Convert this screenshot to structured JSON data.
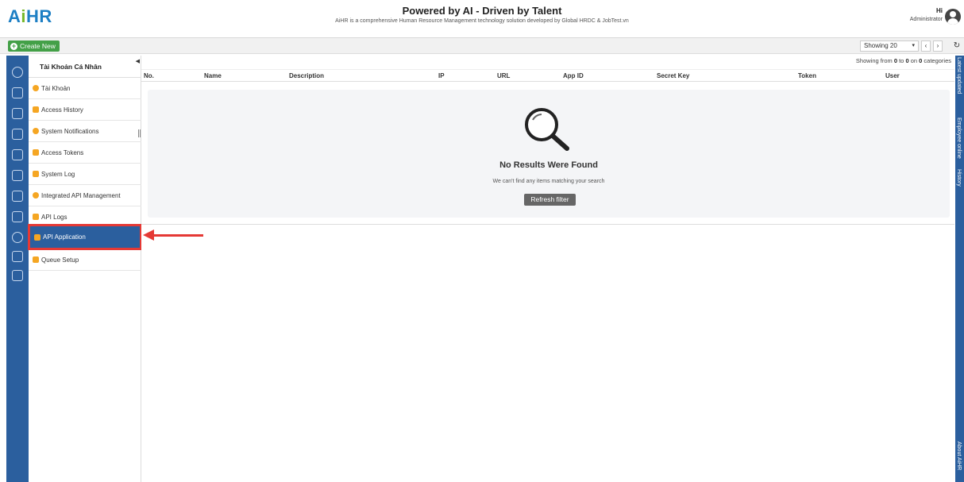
{
  "brand": {
    "logo_a": "A",
    "logo_i": "i",
    "logo_hr": "HR"
  },
  "header": {
    "title": "Powered by AI - Driven by Talent",
    "subtitle": "AiHR is a comprehensive Human Resource Management technology solution developed by Global HRDC & JobTest.vn",
    "greeting": "Hi",
    "role": "Administrator"
  },
  "toolbar": {
    "create_label": "Create New",
    "showing_label": "Showing 20",
    "prev": "‹",
    "next": "›",
    "refresh_icon": "refresh-icon"
  },
  "sidemenu": {
    "title": "Tài Khoản Cá Nhân",
    "items": [
      {
        "label": "Tài Khoản",
        "icon": "user-circle-icon"
      },
      {
        "label": "Access History",
        "icon": "list-icon"
      },
      {
        "label": "System Notifications",
        "icon": "bell-icon"
      },
      {
        "label": "Access Tokens",
        "icon": "key-icon"
      },
      {
        "label": "System Log",
        "icon": "log-icon"
      },
      {
        "label": "Integrated API Management",
        "icon": "cloud-icon"
      },
      {
        "label": "API Logs",
        "icon": "file-icon"
      },
      {
        "label": "API Application",
        "icon": "app-icon"
      },
      {
        "label": "Queue Setup",
        "icon": "queue-icon"
      }
    ],
    "active_index": 7
  },
  "main": {
    "showing_from_prefix": "Showing from ",
    "from": "0",
    "to_word": " to ",
    "to": "0",
    "on_word": " on ",
    "total": "0",
    "suffix": " categories",
    "columns": [
      "No.",
      "Name",
      "Description",
      "IP",
      "URL",
      "App ID",
      "Secret Key",
      "Token",
      "User"
    ],
    "empty_title": "No Results Were Found",
    "empty_subtitle": "We can't find any items matching your search",
    "refresh_button": "Refresh filter"
  },
  "right_rail": {
    "labels": [
      "Latest updated",
      "Employee online",
      "History",
      "About AiHR"
    ]
  },
  "colors": {
    "primary": "#2b5f9e",
    "accent": "#e53935",
    "create": "#43a047"
  }
}
